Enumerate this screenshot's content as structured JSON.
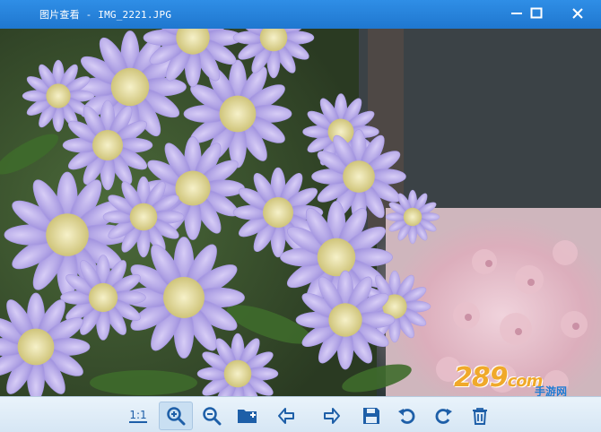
{
  "window": {
    "title": "图片查看 - IMG_2221.JPG",
    "controls": [
      "minimize-icon",
      "maximize-icon",
      "close-icon"
    ]
  },
  "image": {
    "subject": "purple-flowers-photo"
  },
  "watermark": {
    "brand": "289",
    "suffix": "com",
    "subtitle": "手游网"
  },
  "toolbar": {
    "actual_size_label": "1:1",
    "tools": [
      "actual-size",
      "zoom-in-icon",
      "zoom-out-icon",
      "open-folder-icon",
      "previous-arrow-icon",
      "next-arrow-icon",
      "save-icon",
      "rotate-left-icon",
      "rotate-right-icon",
      "delete-icon"
    ]
  },
  "colors": {
    "titlebar": "#2383d8",
    "toolbar": "#e3eef8",
    "icon": "#1e5fa8"
  }
}
